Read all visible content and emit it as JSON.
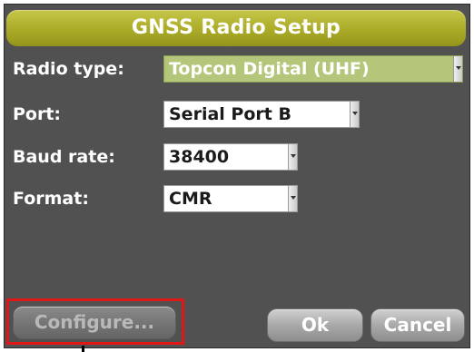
{
  "dialog": {
    "title": "GNSS Radio Setup"
  },
  "fields": {
    "radio_type": {
      "label": "Radio type:",
      "value": "Topcon Digital (UHF)"
    },
    "port": {
      "label": "Port:",
      "value": "Serial Port B"
    },
    "baud_rate": {
      "label": "Baud rate:",
      "value": "38400"
    },
    "format": {
      "label": "Format:",
      "value": "CMR"
    }
  },
  "buttons": {
    "configure": "Configure...",
    "ok": "Ok",
    "cancel": "Cancel"
  },
  "colors": {
    "dialog_background": "#515151",
    "title_bar": "#abab28",
    "selected_field": "#b4c67a",
    "highlight_box": "#e01717"
  },
  "icons": {
    "dropdown": "chevron-down-icon"
  }
}
